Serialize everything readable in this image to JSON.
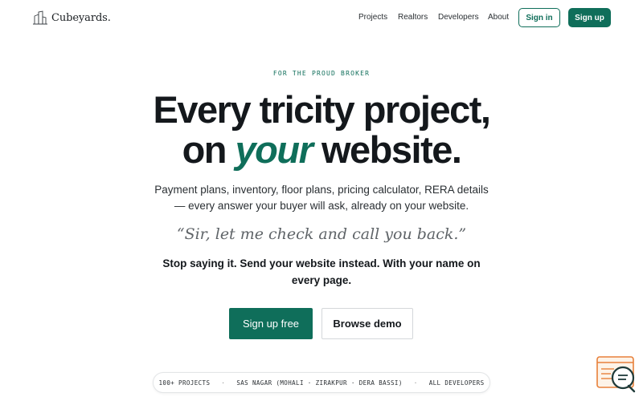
{
  "header": {
    "logo_text": "Cubeyards.",
    "nav": [
      {
        "label": "Projects"
      },
      {
        "label": "Realtors"
      },
      {
        "label": "Developers"
      },
      {
        "label": "About"
      }
    ],
    "signin_label": "Sign in",
    "signup_label": "Sign up"
  },
  "hero": {
    "eyebrow": "FOR THE PROUD BROKER",
    "headline_line1": "Every tricity project,",
    "headline_on": "on",
    "headline_accent": "your",
    "headline_end": "website.",
    "subtext": "Payment plans, inventory, floor plans, pricing calculator, RERA details — every answer your buyer will ask, already on your website.",
    "quote": "“Sir, let me check and call you back.”",
    "callout": "Stop saying it. Send your website instead. With your name on every page.",
    "cta_primary": "Sign up free",
    "cta_secondary": "Browse demo"
  },
  "ticker": {
    "items": [
      "100+ PROJECTS",
      "SAS NAGAR (MOHALI · ZIRAKPUR · DERA BASSI)",
      "ALL DEVELOPERS"
    ],
    "separator": "·"
  },
  "colors": {
    "brand": "#0f6e5a",
    "text": "#14181c",
    "muted": "#5f6468",
    "chat_accent": "#e8803a"
  },
  "icons": {
    "logo": "building-logo-icon",
    "chat": "chat-support-icon"
  }
}
